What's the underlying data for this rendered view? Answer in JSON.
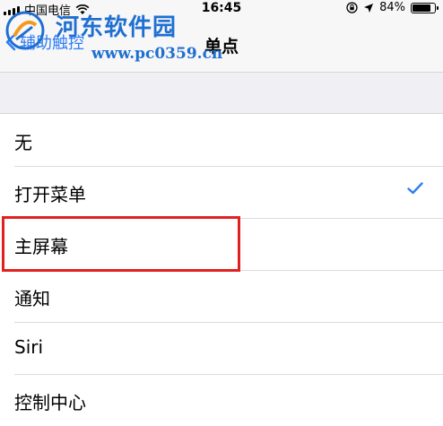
{
  "status_bar": {
    "carrier": "中国电信",
    "time": "16:45",
    "battery_text": "84%",
    "battery_level": 0.84
  },
  "nav": {
    "back_label": "辅助触控",
    "title": "单点"
  },
  "watermark": {
    "title": "河东软件园",
    "site": "www.pc0359.cn"
  },
  "options": [
    {
      "label": "无",
      "selected": false
    },
    {
      "label": "打开菜单",
      "selected": true
    },
    {
      "label": "主屏幕",
      "selected": false
    },
    {
      "label": "通知",
      "selected": false
    },
    {
      "label": "Siri",
      "selected": false
    },
    {
      "label": "控制中心",
      "selected": false
    }
  ],
  "colors": {
    "accent": "#2f7cf6",
    "highlight": "#e32020",
    "section_bg": "#efeff4"
  }
}
